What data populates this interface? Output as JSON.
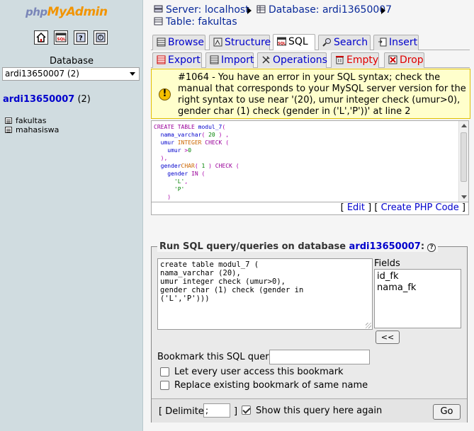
{
  "left": {
    "logo": {
      "php": "php",
      "my": "My",
      "admin": "Admin"
    },
    "nav_icons": [
      "home-icon",
      "sql-query-icon",
      "docs-icon",
      "help-icon"
    ],
    "database_label": "Database",
    "database_select": "ardi13650007 (2)",
    "db_link_name": "ardi13650007",
    "db_link_count": "(2)",
    "tables": [
      "fakultas",
      "mahasiswa"
    ]
  },
  "breadcrumb": {
    "server": "Server: localhost",
    "database": "Database: ardi13650007",
    "table": "Table: fakultas"
  },
  "tabs_row1": [
    {
      "label": "Browse",
      "icon": "browse-icon"
    },
    {
      "label": "Structure",
      "icon": "structure-icon"
    },
    {
      "label": "SQL",
      "icon": "sql-icon"
    },
    {
      "label": "Search",
      "icon": "search-icon"
    },
    {
      "label": "Insert",
      "icon": "insert-icon"
    }
  ],
  "tabs_row2": [
    {
      "label": "Export",
      "icon": "export-icon"
    },
    {
      "label": "Import",
      "icon": "import-icon"
    },
    {
      "label": "Operations",
      "icon": "operations-icon"
    },
    {
      "label": "Empty",
      "icon": "empty-icon"
    },
    {
      "label": "Drop",
      "icon": "drop-icon"
    }
  ],
  "error": {
    "message": "#1064 - You have an error in your SQL syntax; check the manual that corresponds to your MySQL server version for the right syntax to use near '(20), umur integer check (umur>0), gender char (1) check (gender in ('L','P'))' at line 2"
  },
  "code_links": {
    "edit": "Edit",
    "create_php": "Create PHP Code"
  },
  "sql_form": {
    "legend_prefix": "Run SQL query/queries on database",
    "legend_db": "ardi13650007",
    "legend_suffix": ":",
    "query_text": "create table modul_7 (\nnama_varchar (20),\numur integer check (umur>0),\ngender char (1) check (gender in\n('L','P')))",
    "fields_label": "Fields",
    "fields": [
      "id_fk",
      "nama_fk"
    ],
    "insert_button": "<<",
    "bookmark_label": "Bookmark this SQL query:",
    "bookmark_value": "",
    "cb_every_user": "Let every user access this bookmark",
    "cb_replace": "Replace existing bookmark of same name",
    "delimiter_label": "[ Delimiter",
    "delimiter_value": ";",
    "delimiter_close": "]",
    "show_query_label": "Show this query here again",
    "show_query_checked": true,
    "go_button": "Go"
  }
}
